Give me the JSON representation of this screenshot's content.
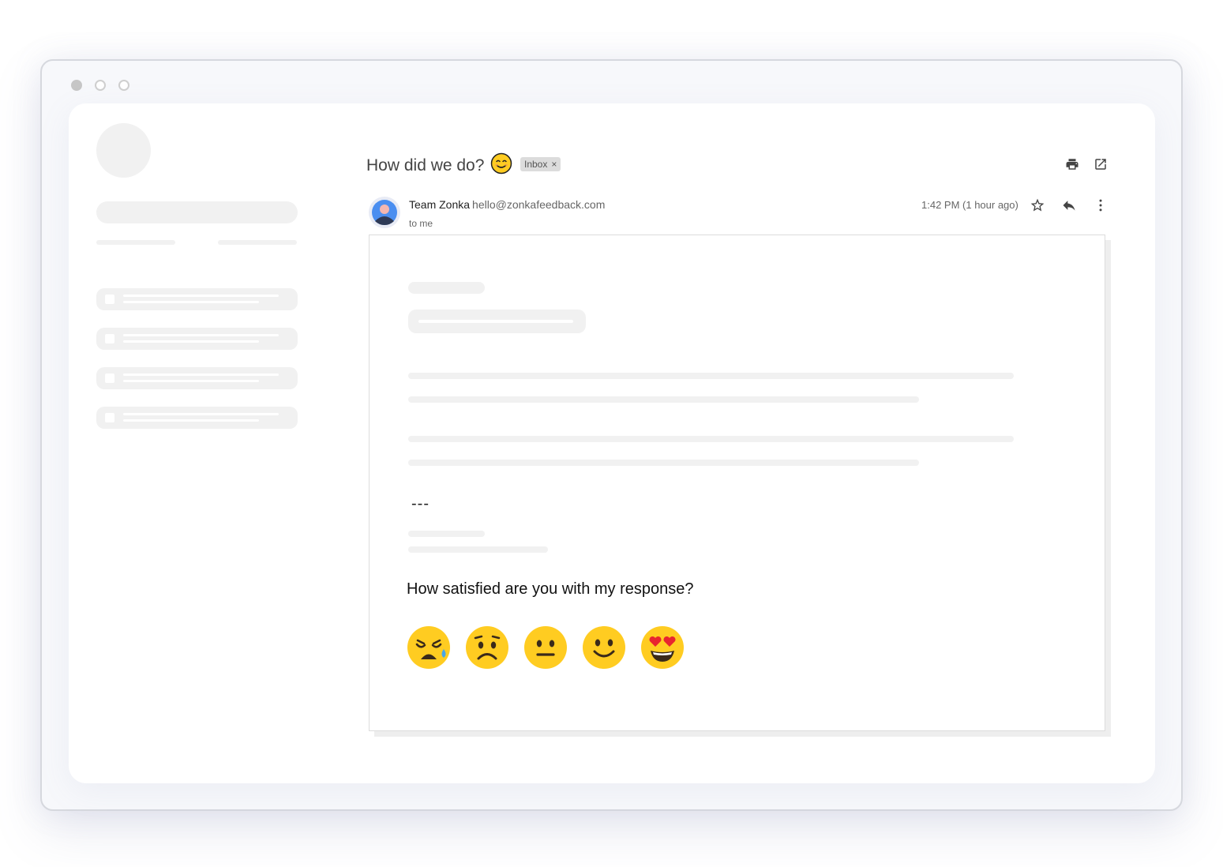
{
  "email": {
    "subject": "How did we do?",
    "label": "Inbox",
    "label_close": "×",
    "sender_name": "Team Zonka",
    "sender_email": "hello@zonkafeedback.com",
    "recipient": "to me",
    "time": "1:42 PM (1 hour ago)",
    "signature_separator": "---",
    "question": "How satisfied are you with my response?"
  },
  "rating_options": [
    "crying-face",
    "frowning-face",
    "neutral-face",
    "smiling-face",
    "heart-eyes-face"
  ],
  "icons": {
    "subject_emoji": "smiling-face-icon",
    "print": "print-icon",
    "open_new_window": "open-in-new-icon",
    "star": "star-icon",
    "reply": "reply-icon",
    "more": "more-vert-icon"
  },
  "colors": {
    "placeholder": "#f1f1f1",
    "emoji_yellow": "#ffcc21",
    "avatar_blue": "#4a8ef0"
  }
}
